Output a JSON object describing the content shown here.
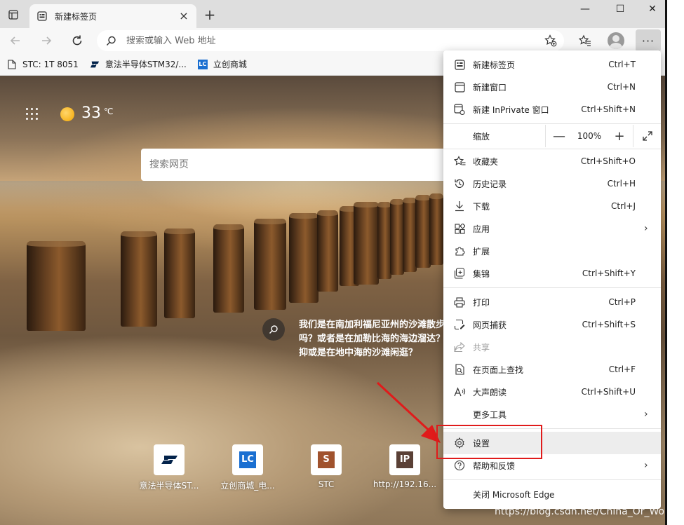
{
  "tab": {
    "title": "新建标签页",
    "close": "×"
  },
  "newtab": "+",
  "window": {
    "minimize": "—",
    "maximize": "☐",
    "close": "✕"
  },
  "toolbar": {
    "address_placeholder": "搜索或输入 Web 地址",
    "more": "···"
  },
  "bookmarks": [
    {
      "label": "STC: 1T 8051",
      "icon": "document-icon"
    },
    {
      "label": "意法半导体STM32/...",
      "icon": "st-logo-icon"
    },
    {
      "label": "立创商城",
      "icon": "lc-logo-icon",
      "badge": "LC"
    }
  ],
  "weather": {
    "temp": "33",
    "unit": "℃"
  },
  "page_search": {
    "placeholder": "搜索网页"
  },
  "image_caption": "我们是在南加利福尼亚州的沙滩散步吗？或者是在加勒比海的海边溜达？抑或是在地中海的沙滩闲逛？",
  "tiles": [
    {
      "label": "意法半导体ST...",
      "glyph": "ST",
      "color": "#03234b"
    },
    {
      "label": "立创商城_电...",
      "glyph": "LC",
      "color": "#1a6fd1"
    },
    {
      "label": "STC",
      "glyph": "S",
      "color": "#a0522d"
    },
    {
      "label": "http://192.16...",
      "glyph": "IP",
      "color": "#5a4036"
    }
  ],
  "menu": {
    "new_tab": {
      "label": "新建标签页",
      "shortcut": "Ctrl+T"
    },
    "new_window": {
      "label": "新建窗口",
      "shortcut": "Ctrl+N"
    },
    "new_inprivate": {
      "label": "新建 InPrivate 窗口",
      "shortcut": "Ctrl+Shift+N"
    },
    "zoom": {
      "label": "缩放",
      "minus": "—",
      "value": "100%",
      "plus": "+"
    },
    "favorites": {
      "label": "收藏夹",
      "shortcut": "Ctrl+Shift+O"
    },
    "history": {
      "label": "历史记录",
      "shortcut": "Ctrl+H"
    },
    "downloads": {
      "label": "下载",
      "shortcut": "Ctrl+J"
    },
    "apps": {
      "label": "应用"
    },
    "extensions": {
      "label": "扩展"
    },
    "collections": {
      "label": "集锦",
      "shortcut": "Ctrl+Shift+Y"
    },
    "print": {
      "label": "打印",
      "shortcut": "Ctrl+P"
    },
    "web_capture": {
      "label": "网页捕获",
      "shortcut": "Ctrl+Shift+S"
    },
    "share": {
      "label": "共享"
    },
    "find": {
      "label": "在页面上查找",
      "shortcut": "Ctrl+F"
    },
    "read_aloud": {
      "label": "大声朗读",
      "shortcut": "Ctrl+Shift+U"
    },
    "more_tools": {
      "label": "更多工具"
    },
    "settings": {
      "label": "设置"
    },
    "help": {
      "label": "帮助和反馈"
    },
    "close_edge": {
      "label": "关闭 Microsoft Edge"
    }
  },
  "watermark": "https://blog.csdn.net/China_Or_World",
  "colors": {
    "highlight": "#e01b1b",
    "accent": "#1a6fd1"
  }
}
